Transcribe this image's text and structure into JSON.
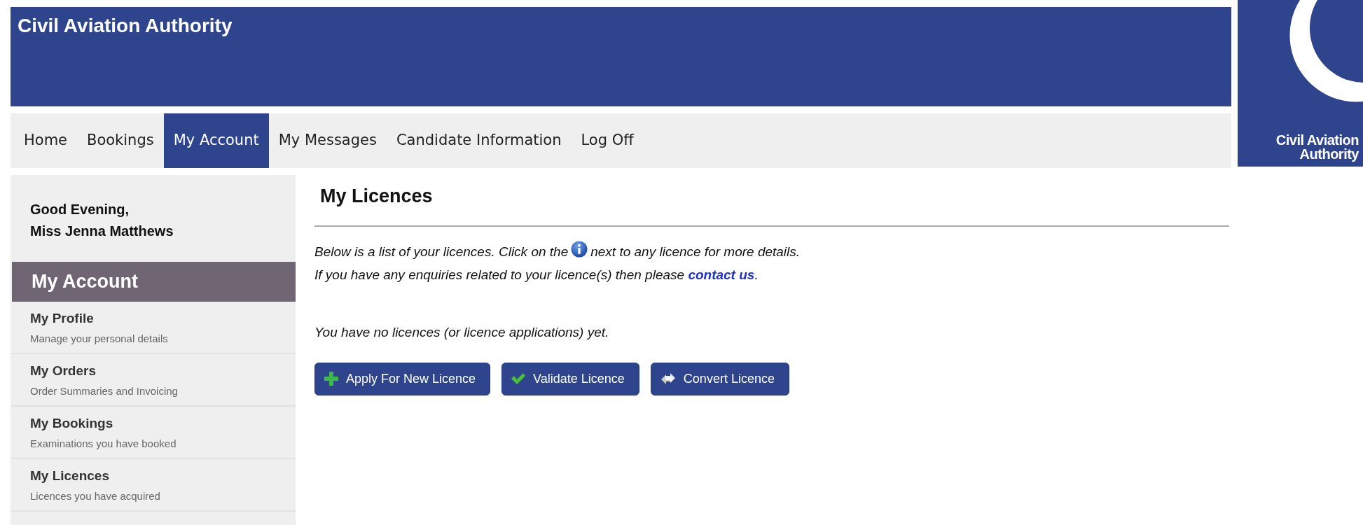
{
  "header": {
    "title": "Civil Aviation Authority"
  },
  "logo": {
    "lines": [
      "Civil Aviation",
      "Authority"
    ]
  },
  "nav": [
    {
      "label": "Home",
      "selected": false
    },
    {
      "label": "Bookings",
      "selected": false
    },
    {
      "label": "My Account",
      "selected": true
    },
    {
      "label": "My Messages",
      "selected": false
    },
    {
      "label": "Candidate Information",
      "selected": false
    },
    {
      "label": "Log Off",
      "selected": false
    }
  ],
  "sidebar": {
    "greeting": [
      "Good Evening,",
      "Miss Jenna Matthews"
    ],
    "heading": "My Account",
    "items": [
      {
        "title": "My Profile",
        "subtitle": "Manage your personal details"
      },
      {
        "title": "My Orders",
        "subtitle": "Order Summaries and Invoicing"
      },
      {
        "title": "My Bookings",
        "subtitle": "Examinations you have booked"
      },
      {
        "title": "My Licences",
        "subtitle": "Licences you have acquired"
      }
    ]
  },
  "content": {
    "title": "My Licences",
    "intro_before_icon": "Below is a list of your licences. Click on the",
    "intro_after_icon": "next to any licence for more details.",
    "enquiry_text": "If you have any enquiries related to your licence(s) then please",
    "enquiry_link": "contact us",
    "enquiry_end": ".",
    "empty_message": "You have no licences (or licence applications) yet.",
    "buttons": [
      {
        "label": "Apply For New Licence",
        "kind": "plus"
      },
      {
        "label": "Validate Licence",
        "kind": "check"
      },
      {
        "label": "Convert Licence",
        "kind": "convert"
      }
    ]
  }
}
